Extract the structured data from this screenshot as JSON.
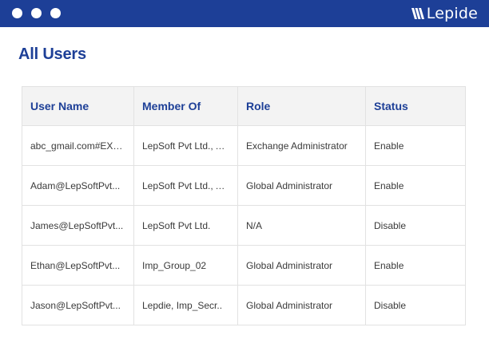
{
  "window": {
    "brand_name": "Lepide",
    "brand_icon": "lepide-logo-icon",
    "header_color": "#1d3f97"
  },
  "page": {
    "title": "All Users"
  },
  "table": {
    "headers": {
      "user_name": "User Name",
      "member_of": "Member Of",
      "role": "Role",
      "status": "Status"
    },
    "rows": [
      {
        "user_name": "abc_gmail.com#EXT...",
        "member_of": "LepSoft Pvt Ltd., All...",
        "role": "Exchange Administrator",
        "status": "Enable"
      },
      {
        "user_name": "Adam@LepSoftPvt...",
        "member_of": "LepSoft Pvt Ltd., All...",
        "role": "Global Administrator",
        "status": "Enable"
      },
      {
        "user_name": "James@LepSoftPvt...",
        "member_of": "LepSoft Pvt Ltd.",
        "role": "N/A",
        "status": "Disable"
      },
      {
        "user_name": "Ethan@LepSoftPvt...",
        "member_of": "Imp_Group_02",
        "role": "Global Administrator",
        "status": "Enable"
      },
      {
        "user_name": "Jason@LepSoftPvt...",
        "member_of": "Lepdie, Imp_Secr..",
        "role": "Global Administrator",
        "status": "Disable"
      }
    ]
  }
}
